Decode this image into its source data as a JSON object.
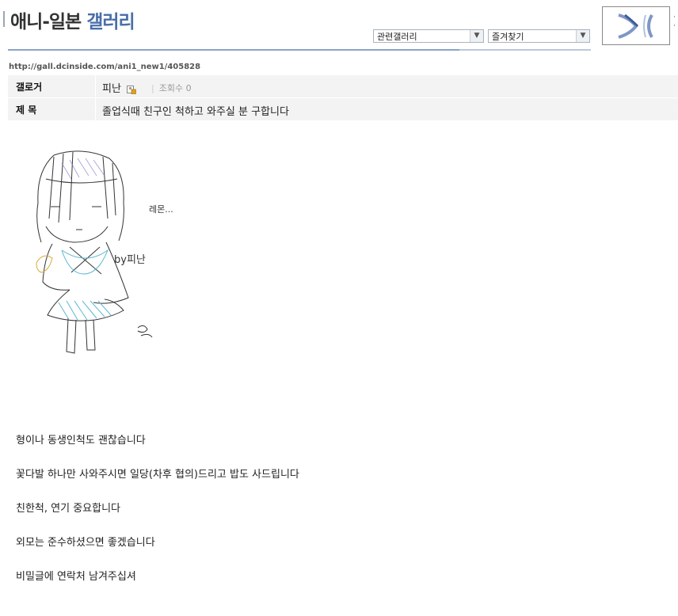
{
  "header": {
    "title_part1": "애니-일본",
    "title_part2": "갤러리",
    "related_select": "관련갤러리",
    "favorites_select": "즐겨찾기"
  },
  "url": "http://gall.dcinside.com/ani1_new1/405828",
  "post": {
    "author_label": "갤로거",
    "author": "피난",
    "views_label": "조회수",
    "views": "0",
    "subject_label": "제 목",
    "subject": "졸업식때 친구인 척하고 와주실 분 구합니다"
  },
  "drawing": {
    "note1": "레몬...",
    "note2": "by피난"
  },
  "body_lines": [
    "형이나 동생인척도 괜찮습니다",
    "꽃다발 하나만 사와주시면 일당(차후 협의)드리고 밥도 사드립니다",
    "친한척, 연기 중요합니다",
    "외모는 준수하셨으면 좋겠습니다",
    "비밀글에 연락처 남겨주십셔"
  ],
  "colors": {
    "accent": "#4a6fa8",
    "row_bg": "#f3f3f3",
    "divider": "#8aa4c8"
  }
}
